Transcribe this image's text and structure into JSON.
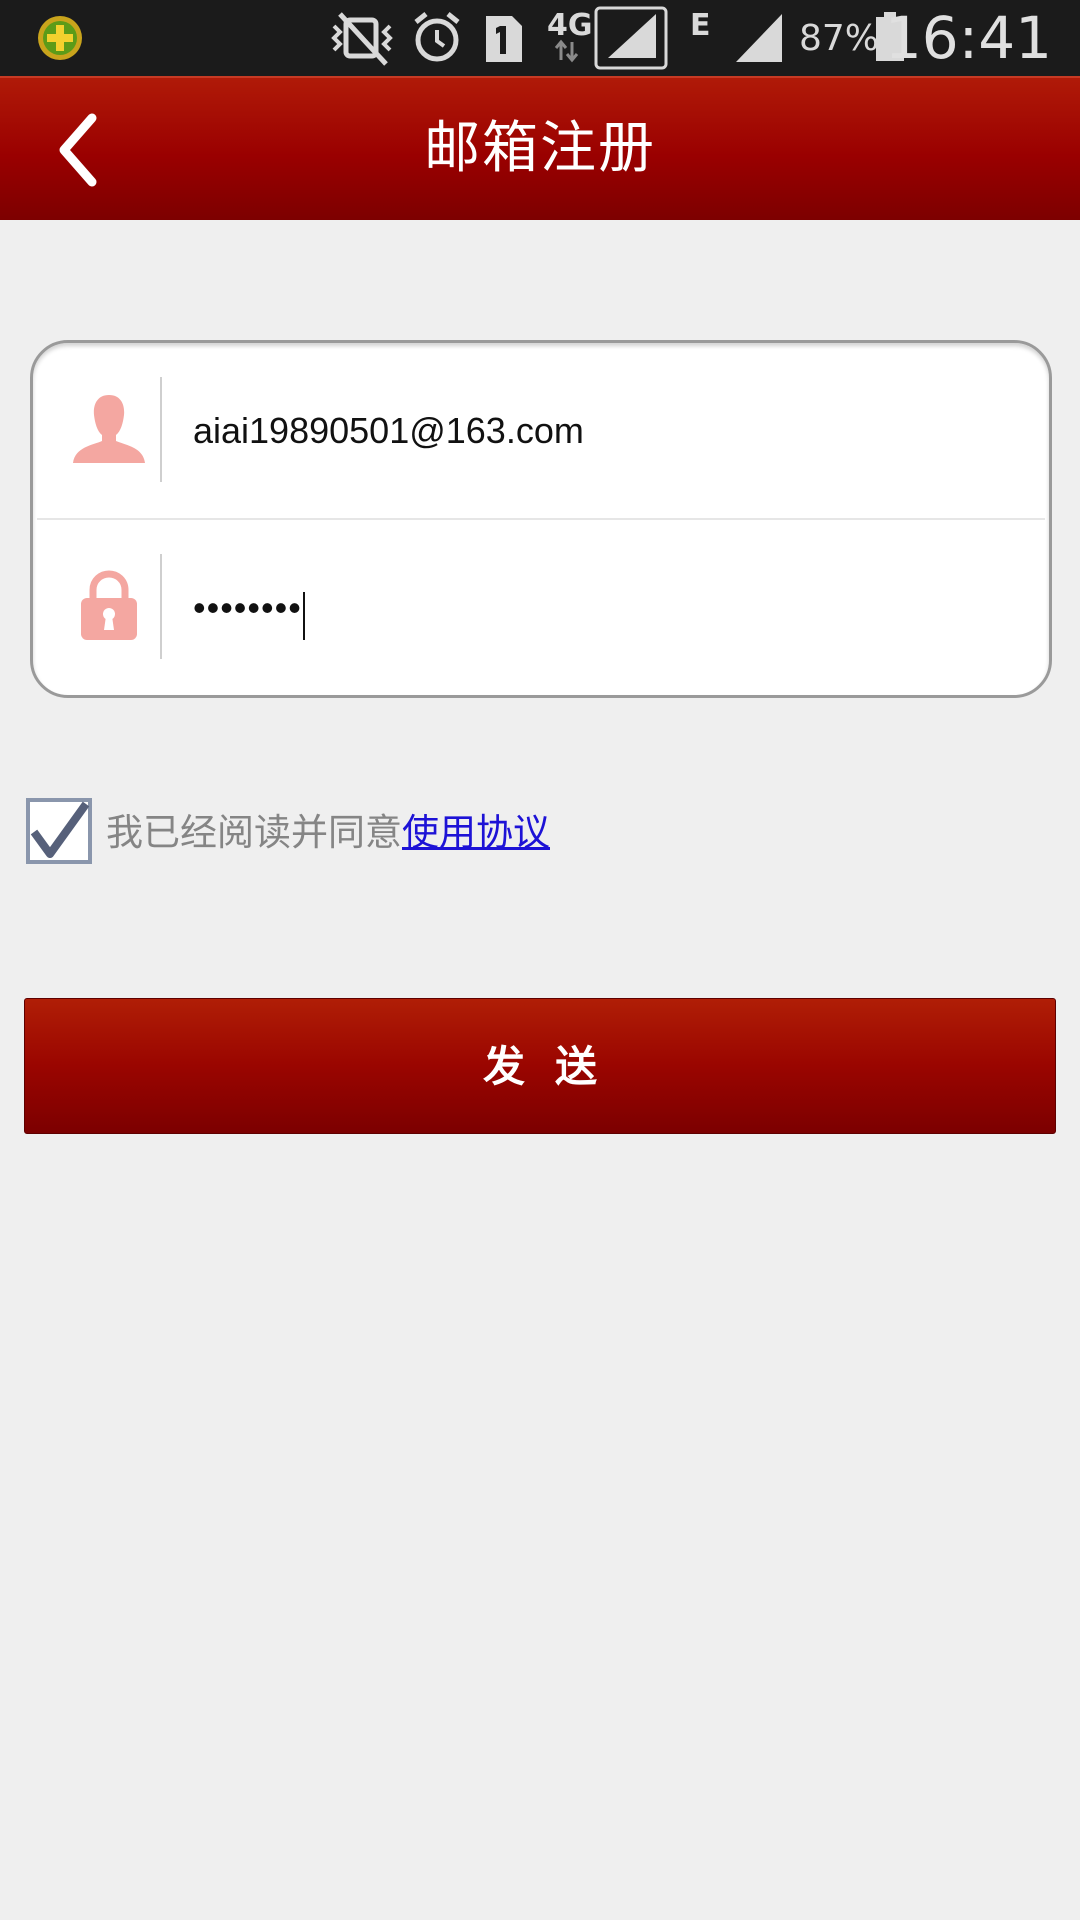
{
  "status_bar": {
    "app_icon": "360-security-icon",
    "icons": [
      "vibrate-mute-icon",
      "alarm-icon",
      "sim1-icon",
      "4g-data-icon",
      "signal-icon",
      "e-signal-icon"
    ],
    "network_label": "4G",
    "edge_label": "E",
    "battery_percent": "87%",
    "time": "16:41"
  },
  "header": {
    "back_icon": "chevron-left-icon",
    "title": "邮箱注册"
  },
  "form": {
    "email_icon": "user-icon",
    "email_value": "aiai19890501@163.com",
    "password_icon": "lock-icon",
    "password_masked": "••••••••"
  },
  "agreement": {
    "checked": true,
    "text": "我已经阅读并同意",
    "link_text": "使用协议"
  },
  "send_button": {
    "label": "发送"
  },
  "colors": {
    "header_red": "#9a0000",
    "link_blue": "#1d12d6",
    "icon_pink": "#f4a7a1"
  }
}
